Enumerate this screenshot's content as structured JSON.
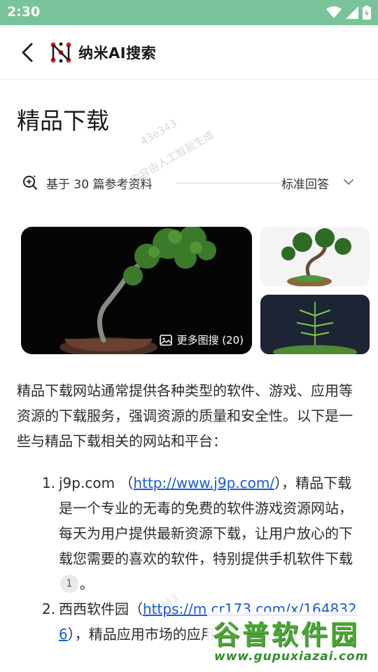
{
  "status_bar": {
    "time": "2:30",
    "icons": [
      "wifi-icon",
      "cell-signal-icon",
      "battery-icon"
    ],
    "background": "#79c39a"
  },
  "header": {
    "back_icon": "chevron-left-icon",
    "app_name": "纳米AI搜索",
    "logo_colors": [
      "#e2232a",
      "#1a1a1a"
    ]
  },
  "page": {
    "title": "精品下载"
  },
  "watermarks": [
    "43e343",
    "内容由人工智能生成"
  ],
  "references": {
    "text": "基于 30 篇参考资料",
    "answer_mode": "标准回答"
  },
  "images": {
    "more_label": "更多图搜 (20)"
  },
  "intro": "精品下载网站通常提供各种类型的软件、游戏、应用等资源的下载服务，强调资源的质量和安全性。以下是一些与精品下载相关的网站和平台：",
  "list": [
    {
      "num": "1.",
      "name": "j9p.com",
      "open_paren": "（",
      "link": "http://www.j9p.com/",
      "desc": "），精品下载是一个专业的无毒的免费的软件游戏资源网站，每天为用户提供最新资源下载，让用户放心的下载您需要的喜欢的软件，特别提供手机软件下载",
      "cite": "1",
      "end": "。"
    },
    {
      "num": "2.",
      "name": "西西软件园",
      "open_paren": "（",
      "link": "https://m.cr173.com/x/1648326",
      "desc": "），精品应用市场",
      "tail": "的应用资源下载平台，"
    }
  ],
  "site_badge": {
    "logo": "谷普软件园",
    "url": "www.gupuxiazai.com",
    "accent": "#4aa832"
  }
}
